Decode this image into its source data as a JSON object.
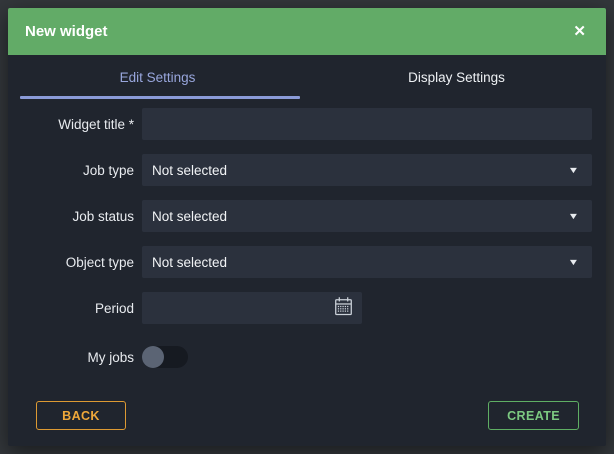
{
  "colors": {
    "header_green": "#62ab67",
    "body_bg": "#20252e",
    "field_bg": "#2b313d",
    "active_tab": "#98a6dc",
    "back_orange": "#efa83a",
    "create_green": "#7cc981"
  },
  "modal": {
    "title": "New widget",
    "icons": {
      "close": "✕",
      "chevron_down": "▼"
    },
    "tabs": [
      {
        "label": "Edit Settings",
        "active": true
      },
      {
        "label": "Display Settings",
        "active": false
      }
    ],
    "form": {
      "widget_title": {
        "label": "Widget title *",
        "value": "",
        "placeholder": ""
      },
      "job_type": {
        "label": "Job type",
        "value": "Not selected"
      },
      "job_status": {
        "label": "Job status",
        "value": "Not selected"
      },
      "object_type": {
        "label": "Object type",
        "value": "Not selected"
      },
      "period": {
        "label": "Period",
        "value": ""
      },
      "my_jobs": {
        "label": "My jobs",
        "state": "off"
      }
    },
    "footer": {
      "back": "BACK",
      "create": "CREATE"
    }
  }
}
